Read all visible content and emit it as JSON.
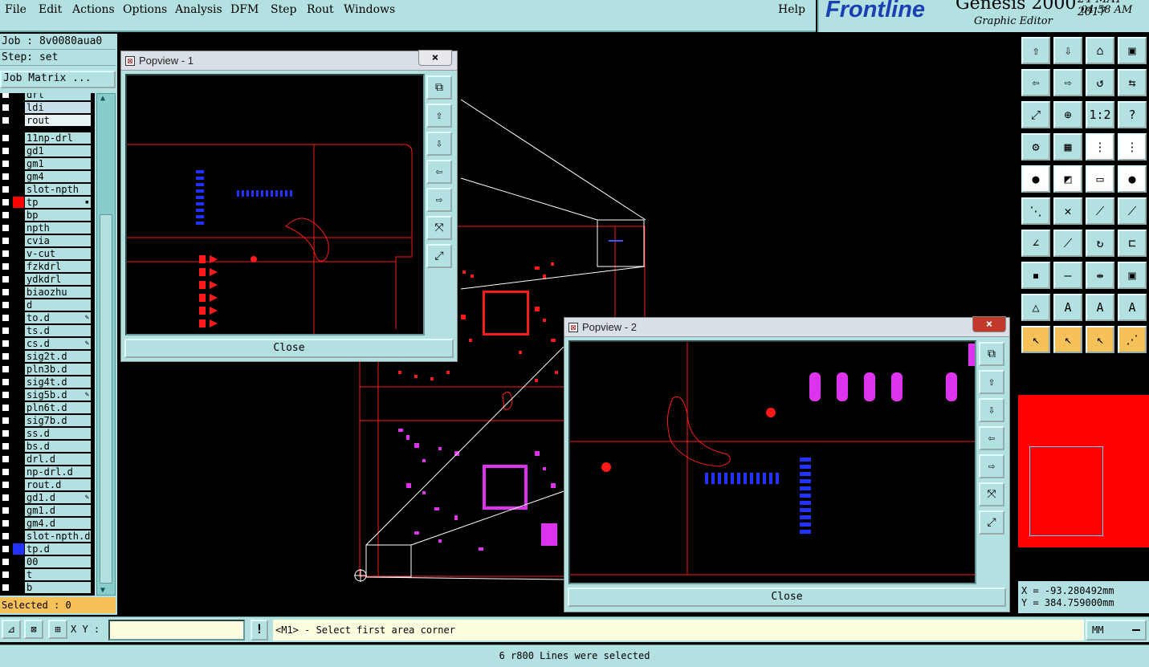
{
  "menubar": {
    "items": [
      {
        "label": "File",
        "u": "F"
      },
      {
        "label": "Edit",
        "u": "E"
      },
      {
        "label": "Actions",
        "u": "A"
      },
      {
        "label": "Options",
        "u": "O"
      },
      {
        "label": "Analysis",
        "u": "A"
      },
      {
        "label": "DFM",
        "u": "D"
      },
      {
        "label": "Step",
        "u": "S"
      },
      {
        "label": "Rout",
        "u": "R"
      },
      {
        "label": "Windows",
        "u": "W"
      }
    ],
    "help": "Help"
  },
  "brand": {
    "logo": "Frontline",
    "title": "Genesis 2000",
    "date": "24-MAY-2017",
    "time": "04:58 AM",
    "subtitle": "Graphic Editor"
  },
  "job": {
    "job_line": "Job : 8v0080aua0",
    "step_line": "Step: set",
    "matrix_button": "Job Matrix ..."
  },
  "layers": [
    {
      "name": "drl",
      "color": "",
      "mark": ""
    },
    {
      "name": "ldi",
      "color": "",
      "mark": "",
      "hl": "#c8e0ec"
    },
    {
      "name": "rout",
      "color": "",
      "mark": "",
      "hl": "#e8f4f4"
    },
    {
      "name": "11np-drl",
      "color": "",
      "mark": ""
    },
    {
      "name": "gd1",
      "color": "",
      "mark": ""
    },
    {
      "name": "gm1",
      "color": "",
      "mark": ""
    },
    {
      "name": "gm4",
      "color": "",
      "mark": ""
    },
    {
      "name": "slot-npth",
      "color": "",
      "mark": ""
    },
    {
      "name": "tp",
      "color": "#ff0000",
      "mark": "▪"
    },
    {
      "name": "bp",
      "color": "",
      "mark": ""
    },
    {
      "name": "npth",
      "color": "",
      "mark": ""
    },
    {
      "name": "cvia",
      "color": "",
      "mark": ""
    },
    {
      "name": "v-cut",
      "color": "",
      "mark": ""
    },
    {
      "name": "fzkdrl",
      "color": "",
      "mark": ""
    },
    {
      "name": "ydkdrl",
      "color": "",
      "mark": ""
    },
    {
      "name": "biaozhu",
      "color": "",
      "mark": ""
    },
    {
      "name": "d",
      "color": "",
      "mark": ""
    },
    {
      "name": "to.d",
      "color": "",
      "mark": "✎"
    },
    {
      "name": "ts.d",
      "color": "",
      "mark": ""
    },
    {
      "name": "cs.d",
      "color": "",
      "mark": "✎"
    },
    {
      "name": "sig2t.d",
      "color": "",
      "mark": ""
    },
    {
      "name": "pln3b.d",
      "color": "",
      "mark": ""
    },
    {
      "name": "sig4t.d",
      "color": "",
      "mark": ""
    },
    {
      "name": "sig5b.d",
      "color": "",
      "mark": "✎"
    },
    {
      "name": "pln6t.d",
      "color": "",
      "mark": ""
    },
    {
      "name": "sig7b.d",
      "color": "",
      "mark": ""
    },
    {
      "name": "ss.d",
      "color": "",
      "mark": ""
    },
    {
      "name": "bs.d",
      "color": "",
      "mark": ""
    },
    {
      "name": "drl.d",
      "color": "",
      "mark": ""
    },
    {
      "name": "np-drl.d",
      "color": "",
      "mark": ""
    },
    {
      "name": "rout.d",
      "color": "",
      "mark": ""
    },
    {
      "name": "gd1.d",
      "color": "",
      "mark": "✎"
    },
    {
      "name": "gm1.d",
      "color": "",
      "mark": ""
    },
    {
      "name": "gm4.d",
      "color": "",
      "mark": ""
    },
    {
      "name": "slot-npth.d",
      "color": "",
      "mark": ""
    },
    {
      "name": "tp.d",
      "color": "#2233ff",
      "mark": ""
    },
    {
      "name": "00",
      "color": "",
      "mark": ""
    },
    {
      "name": "t",
      "color": "",
      "mark": ""
    },
    {
      "name": "b",
      "color": "",
      "mark": ""
    }
  ],
  "selected": "Selected : 0",
  "popview1": {
    "title": "Popview - 1",
    "close_label": "Close",
    "x_label": "×"
  },
  "popview2": {
    "title": "Popview - 2",
    "close_label": "Close",
    "x_label": "×"
  },
  "popview_tools": [
    "⧉",
    "⇧",
    "⇩",
    "⇦",
    "⇨",
    "⤧",
    "⤢"
  ],
  "right_tools": [
    [
      "⇧",
      "⇩",
      "⌂",
      "▣"
    ],
    [
      "⇦",
      "⇨",
      "↺",
      "⇆"
    ],
    [
      "⤢",
      "⊕",
      "1:2",
      "?"
    ],
    [
      "⚙",
      "▦",
      "⋮",
      "⋮"
    ],
    [
      "●",
      "◩",
      "▭",
      "●"
    ],
    [
      "⋱",
      "✕",
      "⟋",
      "⟋"
    ],
    [
      "∠",
      "⟋",
      "↻",
      "⊏"
    ],
    [
      "▪",
      "—",
      "⇹",
      "▣"
    ],
    [
      "△",
      "A",
      "A",
      "A"
    ],
    [
      "↖",
      "↖",
      "↖",
      "⋰"
    ]
  ],
  "coords": {
    "x": "X = -93.280492mm",
    "y": "Y = 384.759000mm"
  },
  "bottom": {
    "xy_label": "X Y :",
    "xy_value": "",
    "excl": "!",
    "prompt": "<M1> - Select first area corner",
    "units": "MM",
    "icons": [
      "⊿",
      "⊠",
      "⊞"
    ]
  },
  "status": "6 r800 Lines were selected",
  "colors": {
    "panel": "#b3e0e0",
    "top_layer": "#ff0000",
    "bottom_layer": "#dd33ee",
    "highlight": "#2233ff",
    "selected_bar": "#f7c15a"
  }
}
